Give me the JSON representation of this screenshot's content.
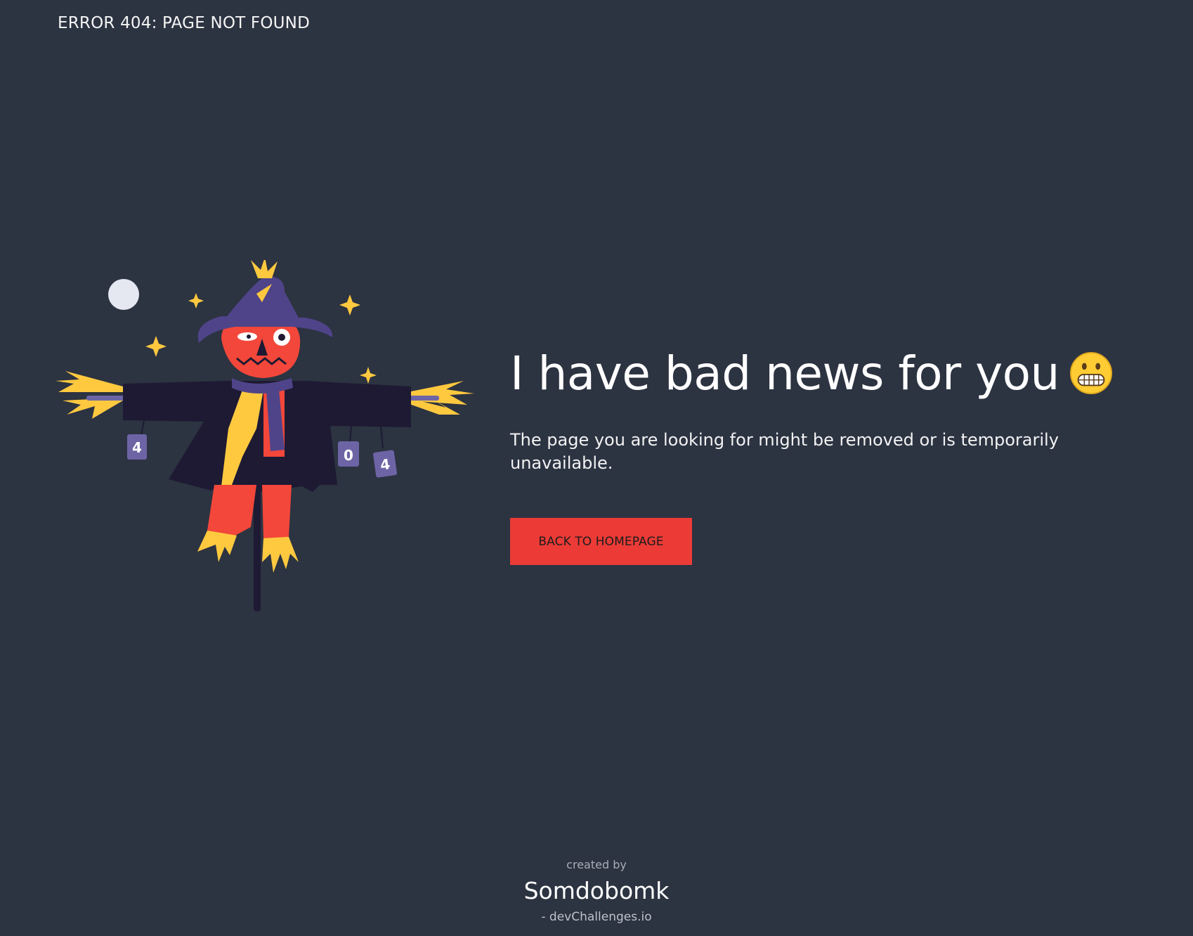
{
  "header": {
    "title": "ERROR 404: PAGE NOT FOUND"
  },
  "main": {
    "headline": "I have bad news for you",
    "emoji": "grimacing-face-icon",
    "message": "The page you are looking for might be removed or is temporarily unavailable.",
    "button_label": "BACK TO HOMEPAGE"
  },
  "illustration": {
    "subject": "scarecrow-illustration",
    "can_labels": [
      "4",
      "0",
      "4"
    ]
  },
  "footer": {
    "created_by": "created by",
    "author": "Somdobomk",
    "site": "- devChallenges.io"
  },
  "colors": {
    "background": "#2c3341",
    "button": "#ec3b36",
    "accent_yellow": "#ffc93f",
    "scarecrow_coat": "#1e1a33",
    "scarecrow_face": "#f2473a",
    "hat": "#4f4489"
  }
}
